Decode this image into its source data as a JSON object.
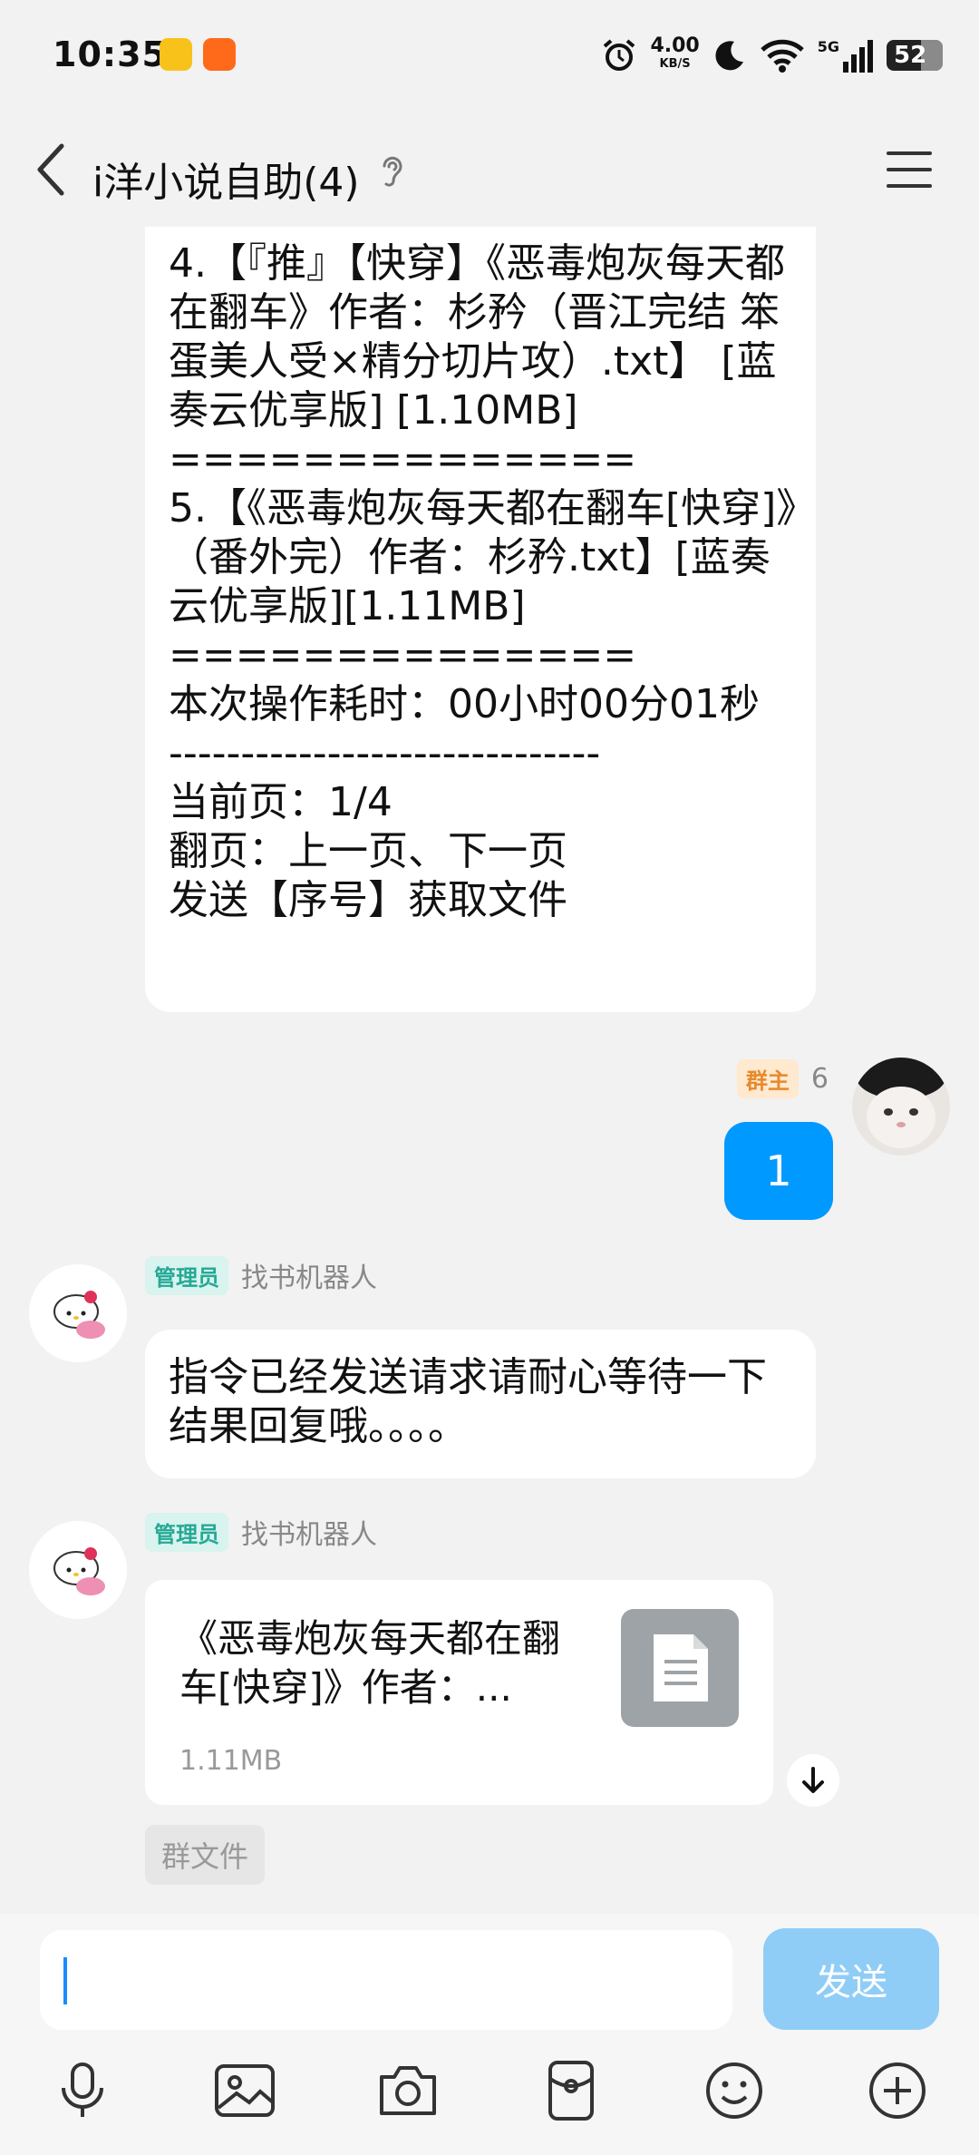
{
  "status_bar": {
    "time": "10:35",
    "speed_value": "4.00",
    "speed_unit": "KB/S",
    "network": "5G",
    "battery": "52"
  },
  "header": {
    "title": "i洋小说自助(4)"
  },
  "messages": {
    "bot_search_result": "--------------\n4.【『推』【快穿】《恶毒炮灰每天都在翻车》作者：杉矜（晋江完结 笨蛋美人受×精分切片攻）.txt】 [蓝奏云优享版] [1.10MB]\n==============\n5.【《恶毒炮灰每天都在翻车[快穿]》（番外完）作者：杉矜.txt】[蓝奏云优享版][1.11MB]\n==============\n本次操作耗时：00小时00分01秒\n------------------------------\n当前页：1/4\n翻页：上一页、下一页\n发送【序号】获取文件",
    "my_message": {
      "badge": "群主",
      "name": "6",
      "text": "1"
    },
    "bot_reply": {
      "badge": "管理员",
      "name": "找书机器人",
      "text": "指令已经发送请求请耐心等待一下结果回复哦。。。。"
    },
    "bot_file": {
      "badge": "管理员",
      "name": "找书机器人",
      "file_name": "《恶毒炮灰每天都在翻车[快穿]》作者：...",
      "file_size": "1.11MB",
      "tag": "群文件"
    }
  },
  "input": {
    "value": "",
    "send_label": "发送"
  },
  "toolbar": [
    "mic-icon",
    "image-icon",
    "camera-icon",
    "red-packet-icon",
    "emoji-icon",
    "plus-icon"
  ]
}
